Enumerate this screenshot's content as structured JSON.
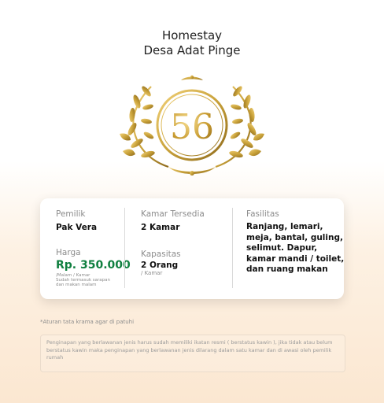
{
  "header": {
    "line1": "Homestay",
    "line2": "Desa Adat Pinge"
  },
  "emblem": {
    "number": "56",
    "gold": "#c9a23a"
  },
  "card": {
    "owner_label": "Pemilik",
    "owner_value": "Pak Vera",
    "price_label": "Harga",
    "price_value": "Rp. 350.000",
    "price_note_1": "/Malam / Kamar",
    "price_note_2": "Sudah termasuk sarapan",
    "price_note_3": "dan makan malam",
    "rooms_label": "Kamar Tersedia",
    "rooms_value": "2 Kamar",
    "capacity_label": "Kapasitas",
    "capacity_value": "2 Orang",
    "capacity_unit": "/ Kamar",
    "facilities_label": "Fasilitas",
    "facilities_text": "Ranjang, lemari, meja, bantal, guling, selimut. Dapur, kamar mandi / toilet, dan ruang makan",
    "price_color": "#0f7f3f"
  },
  "footer": {
    "note": "*Aturan tata krama agar di patuhi",
    "rule": "Penginapan yang berlawanan jenis harus sudah memiliki ikatan resmi ( berstatus kawin ), jika tidak atau belum berstatus kawin maka penginapan yang berlawanan jenis dilarang dalam satu kamar dan di awasi oleh pemilik rumah"
  }
}
